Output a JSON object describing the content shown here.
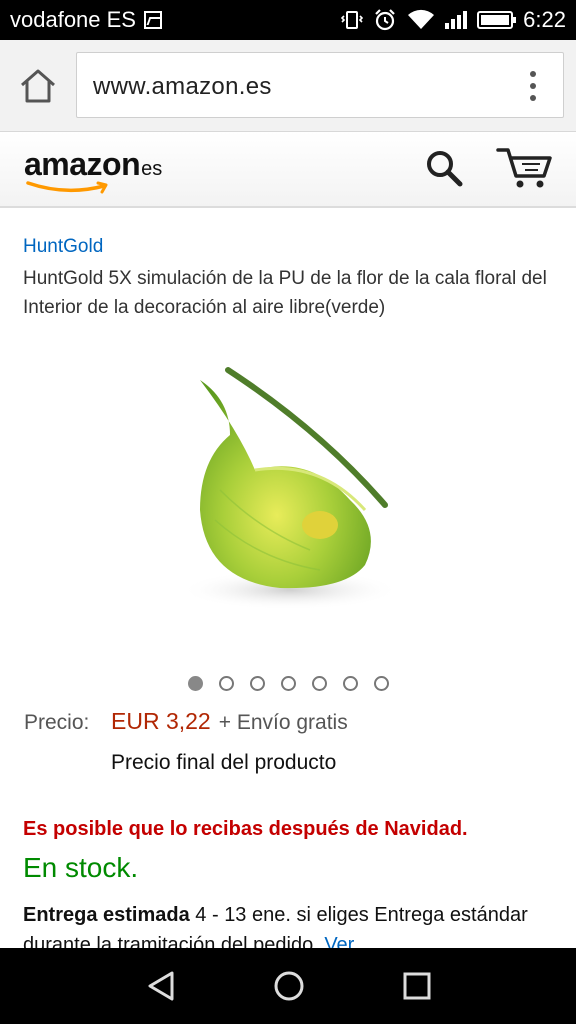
{
  "status_bar": {
    "carrier": "vodafone ES",
    "time": "6:22",
    "icons": [
      "image-notification-icon",
      "vibrate-icon",
      "alarm-icon",
      "wifi-icon",
      "signal-icon",
      "battery-icon"
    ]
  },
  "browser": {
    "url": "www.amazon.es",
    "icons": [
      "home-icon",
      "overflow-menu-icon"
    ]
  },
  "header": {
    "logo_word": "amazon",
    "logo_suffix": "es",
    "icons": [
      "search-icon",
      "cart-icon"
    ]
  },
  "product": {
    "brand": "HuntGold",
    "title": "HuntGold 5X simulación de la PU de la flor de la cala floral del Interior de la decoración al aire libre(verde)",
    "image_count": 7,
    "active_image": 1,
    "price_label": "Precio:",
    "price": "EUR 3,22",
    "shipping": "+ Envío gratis",
    "final_price_note": "Precio final del producto",
    "delay_notice": "Es posible que lo recibas después de Navidad.",
    "stock": "En stock.",
    "delivery_label": "Entrega estimada",
    "delivery_text": " 4 - 13 ene. si eliges Entrega estándar durante la tramitación del pedido.",
    "delivery_link": "Ver"
  },
  "nav": {
    "icons": [
      "back-icon",
      "home-circle-icon",
      "recent-apps-icon"
    ]
  },
  "colors": {
    "price": "#b12704",
    "link": "#0066c0",
    "stock": "#008a00",
    "notice": "#c40000",
    "logo_arrow": "#f90"
  }
}
